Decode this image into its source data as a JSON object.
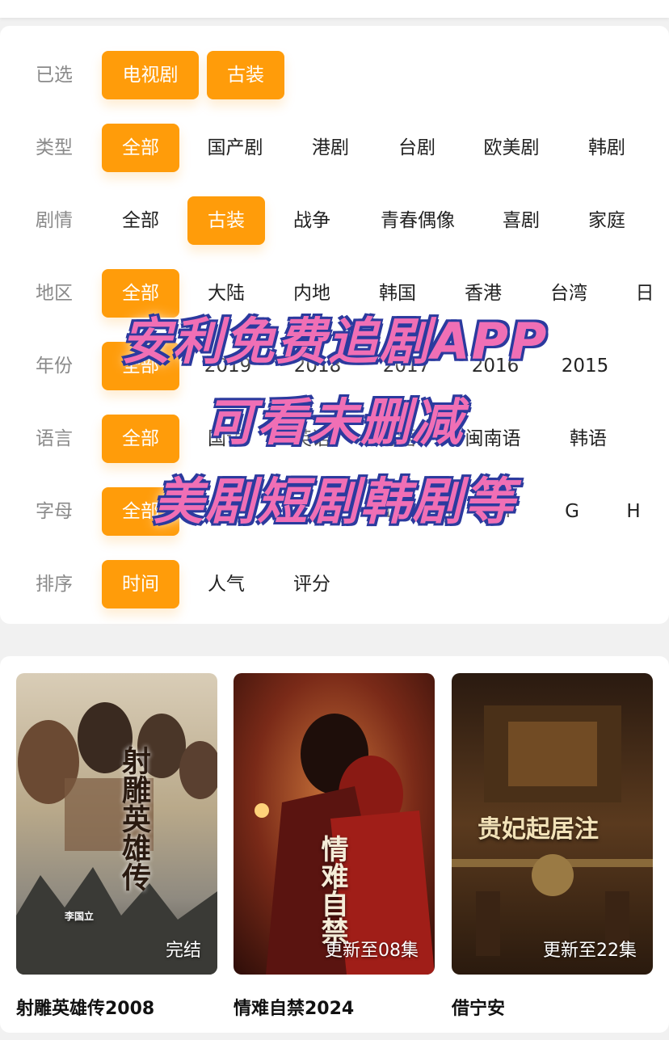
{
  "filters": [
    {
      "label": "已选",
      "options": [
        "电视剧",
        "古装"
      ],
      "selected": [
        0,
        1
      ]
    },
    {
      "label": "类型",
      "options": [
        "全部",
        "国产剧",
        "港剧",
        "台剧",
        "欧美剧",
        "韩剧"
      ],
      "selected": [
        0
      ]
    },
    {
      "label": "剧情",
      "options": [
        "全部",
        "古装",
        "战争",
        "青春偶像",
        "喜剧",
        "家庭"
      ],
      "selected": [
        1
      ]
    },
    {
      "label": "地区",
      "options": [
        "全部",
        "大陆",
        "内地",
        "韩国",
        "香港",
        "台湾",
        "日"
      ],
      "selected": [
        0
      ]
    },
    {
      "label": "年份",
      "options": [
        "全部",
        "2019",
        "2018",
        "2017",
        "2016",
        "2015"
      ],
      "selected": [
        0
      ]
    },
    {
      "label": "语言",
      "options": [
        "全部",
        "国语",
        "英语",
        "粤语",
        "闽南语",
        "韩语"
      ],
      "selected": [
        0
      ]
    },
    {
      "label": "字母",
      "options": [
        "全部",
        "A",
        "B",
        "C",
        "D",
        "E",
        "F",
        "G",
        "H"
      ],
      "selected": [
        0
      ]
    },
    {
      "label": "排序",
      "options": [
        "时间",
        "人气",
        "评分"
      ],
      "selected": [
        0
      ]
    }
  ],
  "overlay_lines": [
    "安利免费追剧APP",
    "可看未删减",
    "美剧短剧韩剧等"
  ],
  "shows": [
    {
      "title": "射雕英雄传2008",
      "badge": "完结",
      "poster_text": "射雕英雄传",
      "poster_sub": "李国立"
    },
    {
      "title": "情难自禁2024",
      "badge": "更新至08集",
      "poster_text": "情难自禁"
    },
    {
      "title": "借宁安",
      "badge": "更新至22集",
      "poster_text": "贵妃起居注"
    }
  ],
  "colors": {
    "accent": "#ff9c0a",
    "overlay_fill": "#f06fb5",
    "overlay_outline": "#2b3a9e"
  }
}
